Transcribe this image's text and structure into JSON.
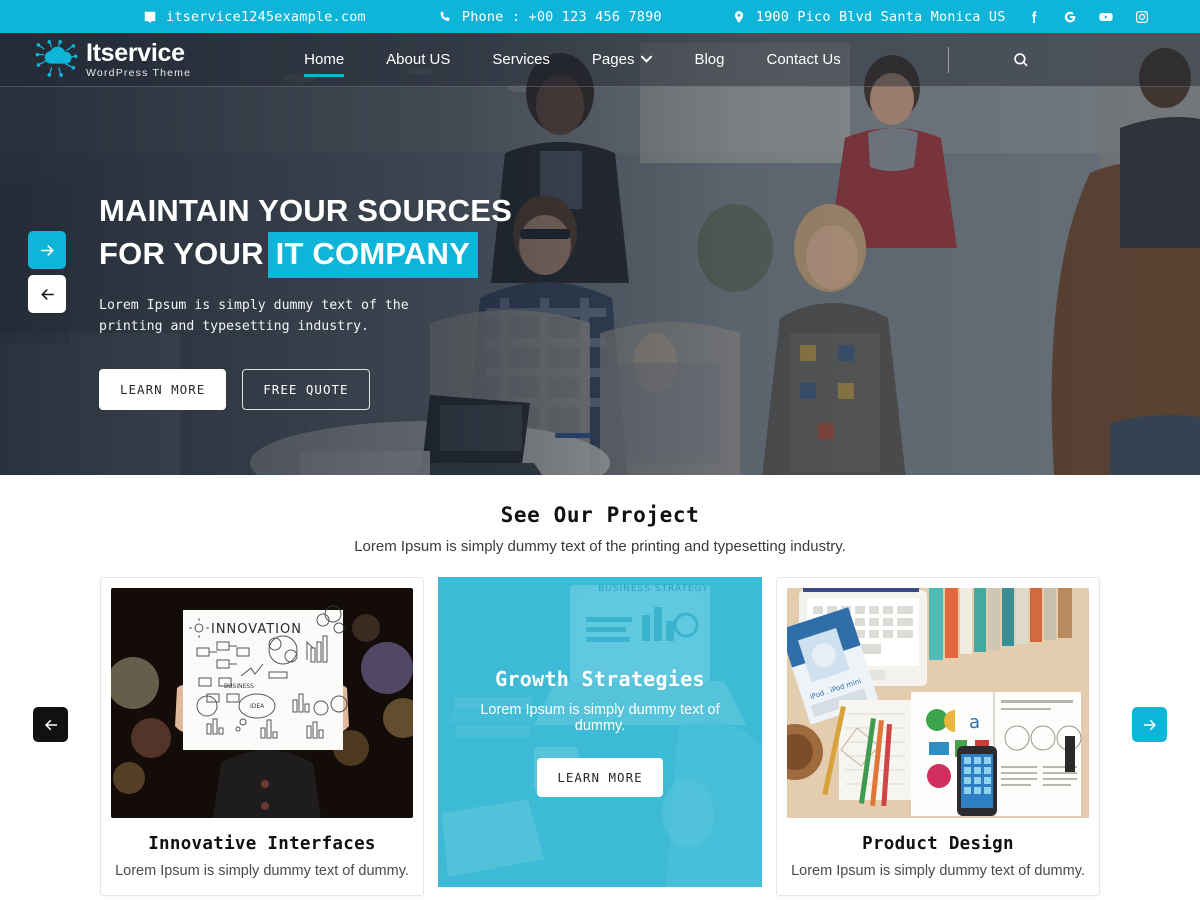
{
  "topbar": {
    "email": "itservice1245example.com",
    "email_icon": "mail-icon",
    "phone": "Phone : +00 123 456 7890",
    "phone_icon": "phone-icon",
    "address": "1900 Pico Blvd Santa Monica US",
    "address_icon": "location-pin-icon",
    "socials": [
      {
        "name": "facebook-icon",
        "label": "f"
      },
      {
        "name": "google-icon",
        "label": "G"
      },
      {
        "name": "youtube-icon",
        "label": "YouTube"
      },
      {
        "name": "instagram-icon",
        "label": "Instagram"
      }
    ],
    "bg_color": "#0fb5d8"
  },
  "header": {
    "logo_title": "Itservice",
    "logo_sub": "WordPress Theme",
    "logo_icon": "circuit-cloud-icon",
    "search_icon": "search-icon",
    "menu": [
      {
        "label": "Home",
        "active": true,
        "has_caret": false
      },
      {
        "label": "About US",
        "active": false,
        "has_caret": false
      },
      {
        "label": "Services",
        "active": false,
        "has_caret": false
      },
      {
        "label": "Pages",
        "active": false,
        "has_caret": true
      },
      {
        "label": "Blog",
        "active": false,
        "has_caret": false
      },
      {
        "label": "Contact Us",
        "active": false,
        "has_caret": false
      }
    ],
    "caret_glyph": "⌄"
  },
  "hero": {
    "title_line1": "MAINTAIN YOUR SOURCES",
    "title_line2_prefix": "FOR YOUR",
    "title_highlight": "IT COMPANY",
    "highlight_color": "#0fb5d8",
    "description": "Lorem Ipsum is simply dummy text of the printing and typesetting industry.",
    "btn_primary": "LEARN MORE",
    "btn_secondary": "FREE QUOTE",
    "next_arrow_icon": "arrow-right-icon",
    "prev_arrow_icon": "arrow-left-icon"
  },
  "projects": {
    "title": "See Our Project",
    "subtitle": "Lorem Ipsum is simply dummy text of the printing and typesetting industry.",
    "prev_icon": "arrow-left-icon",
    "next_icon": "arrow-right-icon",
    "cards": [
      {
        "title": "Innovative Interfaces",
        "text": "Lorem Ipsum is simply dummy text of dummy.",
        "image_alt": "person holding INNOVATION sketch board with bokeh lights",
        "board_label": "INNOVATION"
      },
      {
        "featured": true,
        "title": "Growth Strategies",
        "text": "Lorem Ipsum is simply dummy text of dummy.",
        "button": "LEARN MORE",
        "image_alt": "laptop showing business strategy with teal overlay",
        "screen_label": "BUSINESS STRATEGY"
      },
      {
        "title": "Product Design",
        "text": "Lorem Ipsum is simply dummy text of dummy.",
        "image_alt": "flat lay desk with laptop, books, smartphone and pencils"
      }
    ]
  }
}
